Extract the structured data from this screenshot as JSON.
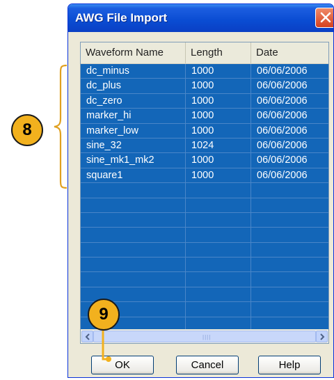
{
  "window": {
    "title": "AWG File Import"
  },
  "table": {
    "headers": [
      "Waveform Name",
      "Length",
      "Date"
    ],
    "rows": [
      {
        "name": "dc_minus",
        "length": "1000",
        "date": "06/06/2006"
      },
      {
        "name": "dc_plus",
        "length": "1000",
        "date": "06/06/2006"
      },
      {
        "name": "dc_zero",
        "length": "1000",
        "date": "06/06/2006"
      },
      {
        "name": "marker_hi",
        "length": "1000",
        "date": "06/06/2006"
      },
      {
        "name": "marker_low",
        "length": "1000",
        "date": "06/06/2006"
      },
      {
        "name": "sine_32",
        "length": "1024",
        "date": "06/06/2006"
      },
      {
        "name": "sine_mk1_mk2",
        "length": "1000",
        "date": "06/06/2006"
      },
      {
        "name": "square1",
        "length": "1000",
        "date": "06/06/2006"
      }
    ],
    "empty_rows": 10
  },
  "buttons": {
    "ok": "OK",
    "cancel": "Cancel",
    "help": "Help"
  },
  "callouts": {
    "rows_marker": "8",
    "ok_marker": "9"
  },
  "colors": {
    "selection": "#1366b8",
    "titlebar": "#0a4cd2",
    "callout": "#f2b11e",
    "bracket": "#e0a020"
  }
}
